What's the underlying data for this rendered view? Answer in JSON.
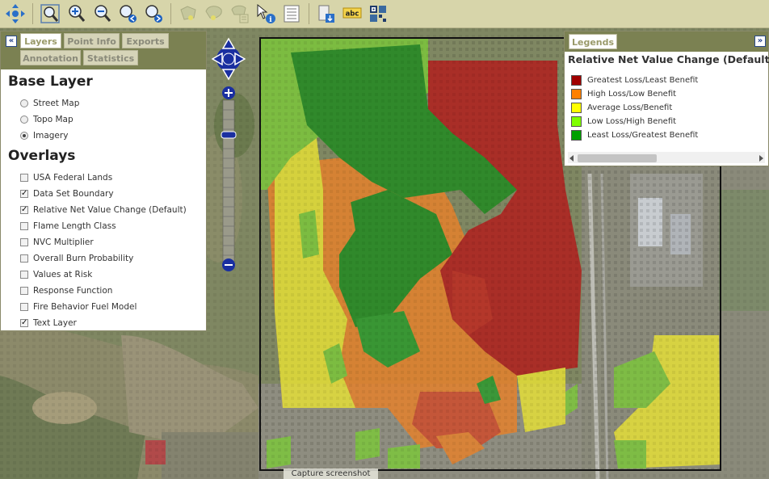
{
  "toolbar": {
    "icons": [
      "pan-icon",
      "zoom-full-extent-icon",
      "zoom-in-icon",
      "zoom-out-icon",
      "zoom-previous-icon",
      "zoom-next-icon",
      "select-polygon-icon",
      "select-freehand-icon",
      "select-clear-icon",
      "identify-icon",
      "attribute-table-icon",
      "export-icon",
      "label-icon",
      "qr-grid-icon"
    ],
    "label_icon_text": "abc"
  },
  "left_panel": {
    "tabs": [
      "Layers",
      "Point Info",
      "Exports",
      "Annotation",
      "Statistics"
    ],
    "active_tab": "Layers",
    "collapse_glyph": "«",
    "base_layer_title": "Base Layer",
    "base_layers": [
      {
        "label": "Street Map",
        "selected": false
      },
      {
        "label": "Topo Map",
        "selected": false
      },
      {
        "label": "Imagery",
        "selected": true
      }
    ],
    "overlays_title": "Overlays",
    "overlays": [
      {
        "label": "USA Federal Lands",
        "checked": false
      },
      {
        "label": "Data Set Boundary",
        "checked": true
      },
      {
        "label": "Relative Net Value Change (Default)",
        "checked": true
      },
      {
        "label": "Flame Length Class",
        "checked": false
      },
      {
        "label": "NVC Multiplier",
        "checked": false
      },
      {
        "label": "Overall Burn Probability",
        "checked": false
      },
      {
        "label": "Values at Risk",
        "checked": false
      },
      {
        "label": "Response Function",
        "checked": false
      },
      {
        "label": "Fire Behavior Fuel Model",
        "checked": false
      },
      {
        "label": "Text Layer",
        "checked": true
      }
    ]
  },
  "legend": {
    "tab": "Legends",
    "collapse_glyph": "»",
    "title": "Relative Net Value Change (Default)",
    "items": [
      {
        "label": "Greatest Loss/Least Benefit",
        "color": "#a00000"
      },
      {
        "label": "High Loss/Low Benefit",
        "color": "#ff8000"
      },
      {
        "label": "Average Loss/Benefit",
        "color": "#ffff00"
      },
      {
        "label": "Low Loss/High Benefit",
        "color": "#7fff00"
      },
      {
        "label": "Least Loss/Greatest Benefit",
        "color": "#00a000"
      }
    ]
  },
  "zoom": {
    "plus": "+",
    "minus": "−"
  },
  "map": {
    "capture_text": "Capture screenshot"
  }
}
